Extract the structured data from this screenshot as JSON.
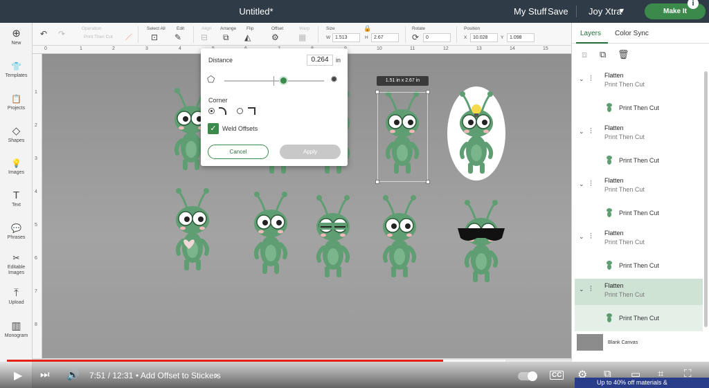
{
  "titlebar": {
    "title": "Untitled*",
    "my_stuff": "My Stuff",
    "save": "Save",
    "profile": "Joy Xtra",
    "profile_chevron": "▾",
    "make_it": "Make It",
    "info": "i"
  },
  "sidebar": {
    "items": [
      {
        "label": "New",
        "icon": "⊕"
      },
      {
        "label": "Templates",
        "icon": "👕"
      },
      {
        "label": "Projects",
        "icon": "📋"
      },
      {
        "label": "Shapes",
        "icon": "◇"
      },
      {
        "label": "Images",
        "icon": "💡"
      },
      {
        "label": "Text",
        "icon": "T"
      },
      {
        "label": "Phrases",
        "icon": "💬"
      },
      {
        "label": "Editable Images",
        "icon": "✂"
      },
      {
        "label": "Upload",
        "icon": "⤒"
      },
      {
        "label": "Monogram",
        "icon": "▥"
      }
    ]
  },
  "toolbar": {
    "operation_label": "Operation",
    "operation_value": "Print Then Cut",
    "select_all": "Select All",
    "edit": "Edit",
    "align": "Align",
    "arrange": "Arrange",
    "flip": "Flip",
    "offset": "Offset",
    "warp": "Warp",
    "size": "Size",
    "w_label": "W",
    "w_value": "1.513",
    "h_label": "H",
    "h_value": "2.67",
    "rotate": "Rotate",
    "rotate_value": "0",
    "position": "Position",
    "x_label": "X",
    "x_value": "10.028",
    "y_label": "Y",
    "y_value": "1.098"
  },
  "ruler": {
    "top": [
      "0",
      "1",
      "2",
      "3",
      "4",
      "5",
      "6",
      "7",
      "8",
      "9",
      "10",
      "11",
      "12",
      "13",
      "14",
      "15"
    ],
    "left": [
      "1",
      "2",
      "3",
      "4",
      "5",
      "6",
      "7",
      "8"
    ]
  },
  "offset_popup": {
    "distance_label": "Distance",
    "distance_value": "0.264",
    "unit": "in",
    "slider_level": 0.6,
    "corner_label": "Corner",
    "weld_label": "Weld Offsets",
    "weld_checked": true,
    "cancel": "Cancel",
    "apply": "Apply"
  },
  "selection": {
    "dimension_label": "1.51  in x 2.67  in"
  },
  "panel": {
    "tab_layers": "Layers",
    "tab_color_sync": "Color Sync",
    "groups": [
      {
        "name": "Flatten",
        "sub": "Print Then Cut",
        "child": "Print Then Cut",
        "selected": false
      },
      {
        "name": "Flatten",
        "sub": "Print Then Cut",
        "child": "Print Then Cut",
        "selected": false
      },
      {
        "name": "Flatten",
        "sub": "Print Then Cut",
        "child": "Print Then Cut",
        "selected": false
      },
      {
        "name": "Flatten",
        "sub": "Print Then Cut",
        "child": "Print Then Cut",
        "selected": false
      },
      {
        "name": "Flatten",
        "sub": "Print Then Cut",
        "child": "Print Then Cut",
        "selected": true
      }
    ],
    "blank_canvas": "Blank Canvas"
  },
  "video": {
    "time": "7:51 / 12:31",
    "chapter": "• Add Offset to Stickers",
    "chapter_chevron": "›",
    "progress": 0.627,
    "promo": "Up to 40% off materials &"
  },
  "colors": {
    "brand_green": "#3b8a4c",
    "bug_green": "#5f9e72",
    "titlebar": "#2f3b47",
    "progress_red": "#e62117"
  }
}
